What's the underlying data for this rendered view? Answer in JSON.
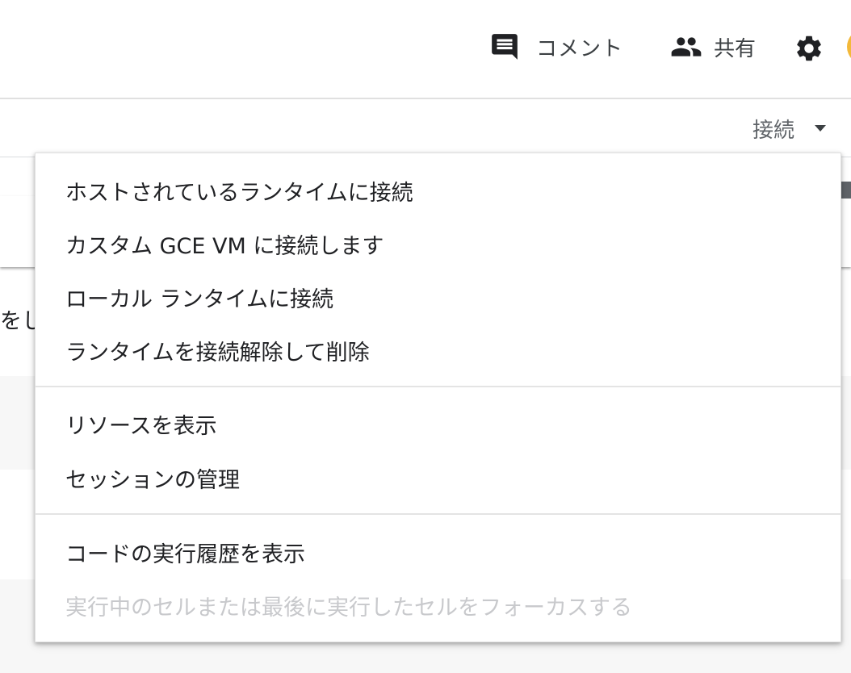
{
  "header": {
    "comment_label": "コメント",
    "share_label": "共有",
    "icons": {
      "comment": "comment-icon",
      "share": "people-icon",
      "settings": "gear-icon"
    },
    "avatar_color": "#f3b93a"
  },
  "toolbar": {
    "connect_label": "接続"
  },
  "background": {
    "partial_text": "をし"
  },
  "menu": {
    "items": [
      {
        "label": "ホストされているランタイムに接続",
        "enabled": true
      },
      {
        "label": "カスタム GCE VM に接続します",
        "enabled": true
      },
      {
        "label": "ローカル ランタイムに接続",
        "enabled": true
      },
      {
        "label": "ランタイムを接続解除して削除",
        "enabled": true
      },
      {
        "label": "リソースを表示",
        "enabled": true
      },
      {
        "label": "セッションの管理",
        "enabled": true
      },
      {
        "label": "コードの実行履歴を表示",
        "enabled": true
      },
      {
        "label": "実行中のセルまたは最後に実行したセルをフォーカスする",
        "enabled": false
      }
    ]
  },
  "colors": {
    "text": "#202124",
    "muted": "#5f6368",
    "disabled": "#c8c9cc",
    "divider": "#e4e4e4"
  }
}
